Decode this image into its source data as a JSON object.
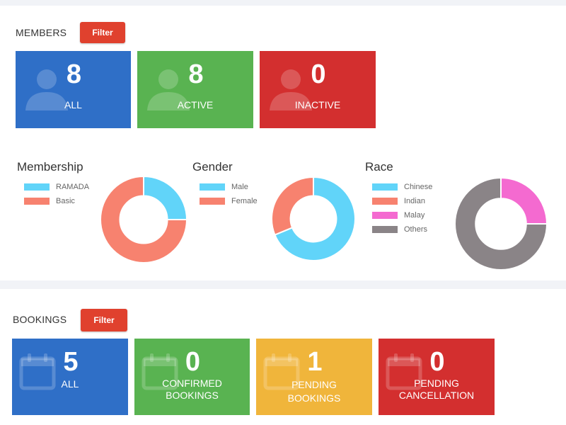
{
  "members": {
    "title": "MEMBERS",
    "filter_label": "Filter",
    "tiles": [
      {
        "value": "8",
        "label": "ALL",
        "color": "#2f6fc7",
        "icon": "user-icon"
      },
      {
        "value": "8",
        "label": "ACTIVE",
        "color": "#59b351",
        "icon": "user-icon"
      },
      {
        "value": "0",
        "label": "INACTIVE",
        "color": "#d32f2f",
        "icon": "user-icon"
      }
    ]
  },
  "charts": {
    "membership": {
      "title": "Membership",
      "legend": [
        {
          "label": "RAMADA",
          "color": "#61d4f9"
        },
        {
          "label": "Basic",
          "color": "#f7826f"
        }
      ]
    },
    "gender": {
      "title": "Gender",
      "legend": [
        {
          "label": "Male",
          "color": "#61d4f9"
        },
        {
          "label": "Female",
          "color": "#f7826f"
        }
      ]
    },
    "race": {
      "title": "Race",
      "legend": [
        {
          "label": "Chinese",
          "color": "#61d4f9"
        },
        {
          "label": "Indian",
          "color": "#f7826f"
        },
        {
          "label": "Malay",
          "color": "#f46ad0"
        },
        {
          "label": "Others",
          "color": "#8a8487"
        }
      ]
    }
  },
  "chart_data": [
    {
      "type": "pie",
      "title": "Membership",
      "categories": [
        "RAMADA",
        "Basic"
      ],
      "values": [
        2,
        6
      ],
      "donut": true
    },
    {
      "type": "pie",
      "title": "Gender",
      "categories": [
        "Male",
        "Female"
      ],
      "values": [
        5.5,
        2.5
      ],
      "donut": true
    },
    {
      "type": "pie",
      "title": "Race",
      "categories": [
        "Chinese",
        "Indian",
        "Malay",
        "Others"
      ],
      "values": [
        0,
        0,
        2,
        6
      ],
      "donut": true
    }
  ],
  "bookings": {
    "title": "BOOKINGS",
    "filter_label": "Filter",
    "tiles": [
      {
        "value": "5",
        "label": "ALL",
        "color": "#2f6fc7",
        "icon": "calendar-icon"
      },
      {
        "value": "0",
        "label": "CONFIRMED\nBOOKINGS",
        "color": "#59b351",
        "icon": "calendar-icon"
      },
      {
        "value": "1",
        "label": "PENDING\nBOOKINGS",
        "color": "#f0b53b",
        "icon": "calendar-icon"
      },
      {
        "value": "0",
        "label": "PENDING\nCANCELLATION",
        "color": "#d32f2f",
        "icon": "calendar-icon"
      }
    ]
  },
  "colors": {
    "filter_button": "#e0412e",
    "page_bg": "#f1f3f7"
  }
}
